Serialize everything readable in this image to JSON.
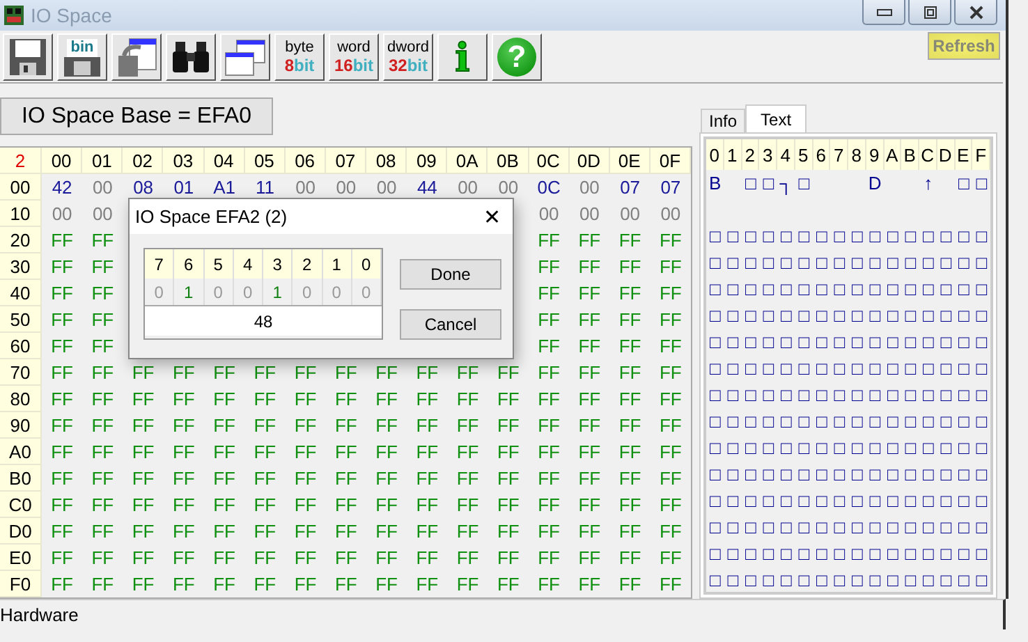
{
  "window": {
    "title": "IO Space"
  },
  "toolbar": [
    {
      "kind": "save"
    },
    {
      "kind": "bin",
      "label": "bin"
    },
    {
      "kind": "copy"
    },
    {
      "kind": "find"
    },
    {
      "kind": "windows"
    },
    {
      "kind": "size",
      "top": "byte",
      "num": "8",
      "unit": "bit"
    },
    {
      "kind": "size",
      "top": "word",
      "num": "16",
      "unit": "bit"
    },
    {
      "kind": "size",
      "top": "dword",
      "num": "32",
      "unit": "bit"
    },
    {
      "kind": "info",
      "glyph": "i"
    },
    {
      "kind": "help",
      "glyph": "?"
    }
  ],
  "refresh_button": "Refresh",
  "base_label": "IO Space Base = EFA0",
  "grid": {
    "corner": "2",
    "columns": [
      "00",
      "01",
      "02",
      "03",
      "04",
      "05",
      "06",
      "07",
      "08",
      "09",
      "0A",
      "0B",
      "0C",
      "0D",
      "0E",
      "0F"
    ],
    "rows": [
      {
        "label": "00",
        "cells": [
          {
            "text": "42",
            "kind": "data"
          },
          {
            "text": "00",
            "kind": "zero"
          },
          {
            "text": "08",
            "kind": "data"
          },
          {
            "text": "01",
            "kind": "data"
          },
          {
            "text": "A1",
            "kind": "data"
          },
          {
            "text": "11",
            "kind": "data"
          },
          {
            "text": "00",
            "kind": "zero"
          },
          {
            "text": "00",
            "kind": "zero"
          },
          {
            "text": "00",
            "kind": "zero"
          },
          {
            "text": "44",
            "kind": "data"
          },
          {
            "text": "00",
            "kind": "zero"
          },
          {
            "text": "00",
            "kind": "zero"
          },
          {
            "text": "0C",
            "kind": "data"
          },
          {
            "text": "00",
            "kind": "zero"
          },
          {
            "text": "07",
            "kind": "data"
          },
          {
            "text": "07",
            "kind": "data"
          }
        ]
      },
      {
        "label": "10",
        "cells": [
          {
            "text": "00",
            "kind": "zero"
          },
          {
            "text": "00",
            "kind": "zero"
          },
          null,
          null,
          null,
          null,
          null,
          null,
          null,
          null,
          null,
          null,
          {
            "text": "00",
            "kind": "zero"
          },
          {
            "text": "00",
            "kind": "zero"
          },
          {
            "text": "00",
            "kind": "zero"
          },
          {
            "text": "00",
            "kind": "zero"
          }
        ]
      },
      {
        "label": "20",
        "cells": [
          {
            "text": "FF",
            "kind": "full"
          },
          {
            "text": "FF",
            "kind": "full"
          },
          null,
          null,
          null,
          null,
          null,
          null,
          null,
          null,
          null,
          null,
          {
            "text": "FF",
            "kind": "full"
          },
          {
            "text": "FF",
            "kind": "full"
          },
          {
            "text": "FF",
            "kind": "full"
          },
          {
            "text": "FF",
            "kind": "full"
          }
        ]
      },
      {
        "label": "30",
        "cells": [
          {
            "text": "FF",
            "kind": "full"
          },
          {
            "text": "FF",
            "kind": "full"
          },
          null,
          null,
          null,
          null,
          null,
          null,
          null,
          null,
          null,
          null,
          {
            "text": "FF",
            "kind": "full"
          },
          {
            "text": "FF",
            "kind": "full"
          },
          {
            "text": "FF",
            "kind": "full"
          },
          {
            "text": "FF",
            "kind": "full"
          }
        ]
      },
      {
        "label": "40",
        "cells": [
          {
            "text": "FF",
            "kind": "full"
          },
          {
            "text": "FF",
            "kind": "full"
          },
          null,
          null,
          null,
          null,
          null,
          null,
          null,
          null,
          null,
          null,
          {
            "text": "FF",
            "kind": "full"
          },
          {
            "text": "FF",
            "kind": "full"
          },
          {
            "text": "FF",
            "kind": "full"
          },
          {
            "text": "FF",
            "kind": "full"
          }
        ]
      },
      {
        "label": "50",
        "cells": [
          {
            "text": "FF",
            "kind": "full"
          },
          {
            "text": "FF",
            "kind": "full"
          },
          null,
          null,
          null,
          null,
          null,
          null,
          null,
          null,
          null,
          null,
          {
            "text": "FF",
            "kind": "full"
          },
          {
            "text": "FF",
            "kind": "full"
          },
          {
            "text": "FF",
            "kind": "full"
          },
          {
            "text": "FF",
            "kind": "full"
          }
        ]
      },
      {
        "label": "60",
        "cells": [
          {
            "text": "FF",
            "kind": "full"
          },
          {
            "text": "FF",
            "kind": "full"
          },
          null,
          null,
          null,
          null,
          null,
          null,
          null,
          null,
          null,
          null,
          {
            "text": "FF",
            "kind": "full"
          },
          {
            "text": "FF",
            "kind": "full"
          },
          {
            "text": "FF",
            "kind": "full"
          },
          {
            "text": "FF",
            "kind": "full"
          }
        ]
      },
      {
        "label": "70",
        "cells": [
          {
            "text": "FF",
            "kind": "full"
          },
          {
            "text": "FF",
            "kind": "full"
          },
          {
            "text": "FF",
            "kind": "full"
          },
          {
            "text": "FF",
            "kind": "full"
          },
          {
            "text": "FF",
            "kind": "full"
          },
          {
            "text": "FF",
            "kind": "full"
          },
          {
            "text": "FF",
            "kind": "full"
          },
          {
            "text": "FF",
            "kind": "full"
          },
          {
            "text": "FF",
            "kind": "full"
          },
          {
            "text": "FF",
            "kind": "full"
          },
          {
            "text": "FF",
            "kind": "full"
          },
          {
            "text": "FF",
            "kind": "full"
          },
          {
            "text": "FF",
            "kind": "full"
          },
          {
            "text": "FF",
            "kind": "full"
          },
          {
            "text": "FF",
            "kind": "full"
          },
          {
            "text": "FF",
            "kind": "full"
          }
        ]
      },
      {
        "label": "80",
        "cells": [
          {
            "text": "FF",
            "kind": "full"
          },
          {
            "text": "FF",
            "kind": "full"
          },
          {
            "text": "FF",
            "kind": "full"
          },
          {
            "text": "FF",
            "kind": "full"
          },
          {
            "text": "FF",
            "kind": "full"
          },
          {
            "text": "FF",
            "kind": "full"
          },
          {
            "text": "FF",
            "kind": "full"
          },
          {
            "text": "FF",
            "kind": "full"
          },
          {
            "text": "FF",
            "kind": "full"
          },
          {
            "text": "FF",
            "kind": "full"
          },
          {
            "text": "FF",
            "kind": "full"
          },
          {
            "text": "FF",
            "kind": "full"
          },
          {
            "text": "FF",
            "kind": "full"
          },
          {
            "text": "FF",
            "kind": "full"
          },
          {
            "text": "FF",
            "kind": "full"
          },
          {
            "text": "FF",
            "kind": "full"
          }
        ]
      },
      {
        "label": "90",
        "cells": [
          {
            "text": "FF",
            "kind": "full"
          },
          {
            "text": "FF",
            "kind": "full"
          },
          {
            "text": "FF",
            "kind": "full"
          },
          {
            "text": "FF",
            "kind": "full"
          },
          {
            "text": "FF",
            "kind": "full"
          },
          {
            "text": "FF",
            "kind": "full"
          },
          {
            "text": "FF",
            "kind": "full"
          },
          {
            "text": "FF",
            "kind": "full"
          },
          {
            "text": "FF",
            "kind": "full"
          },
          {
            "text": "FF",
            "kind": "full"
          },
          {
            "text": "FF",
            "kind": "full"
          },
          {
            "text": "FF",
            "kind": "full"
          },
          {
            "text": "FF",
            "kind": "full"
          },
          {
            "text": "FF",
            "kind": "full"
          },
          {
            "text": "FF",
            "kind": "full"
          },
          {
            "text": "FF",
            "kind": "full"
          }
        ]
      },
      {
        "label": "A0",
        "cells": [
          {
            "text": "FF",
            "kind": "full"
          },
          {
            "text": "FF",
            "kind": "full"
          },
          {
            "text": "FF",
            "kind": "full"
          },
          {
            "text": "FF",
            "kind": "full"
          },
          {
            "text": "FF",
            "kind": "full"
          },
          {
            "text": "FF",
            "kind": "full"
          },
          {
            "text": "FF",
            "kind": "full"
          },
          {
            "text": "FF",
            "kind": "full"
          },
          {
            "text": "FF",
            "kind": "full"
          },
          {
            "text": "FF",
            "kind": "full"
          },
          {
            "text": "FF",
            "kind": "full"
          },
          {
            "text": "FF",
            "kind": "full"
          },
          {
            "text": "FF",
            "kind": "full"
          },
          {
            "text": "FF",
            "kind": "full"
          },
          {
            "text": "FF",
            "kind": "full"
          },
          {
            "text": "FF",
            "kind": "full"
          }
        ]
      },
      {
        "label": "B0",
        "cells": [
          {
            "text": "FF",
            "kind": "full"
          },
          {
            "text": "FF",
            "kind": "full"
          },
          {
            "text": "FF",
            "kind": "full"
          },
          {
            "text": "FF",
            "kind": "full"
          },
          {
            "text": "FF",
            "kind": "full"
          },
          {
            "text": "FF",
            "kind": "full"
          },
          {
            "text": "FF",
            "kind": "full"
          },
          {
            "text": "FF",
            "kind": "full"
          },
          {
            "text": "FF",
            "kind": "full"
          },
          {
            "text": "FF",
            "kind": "full"
          },
          {
            "text": "FF",
            "kind": "full"
          },
          {
            "text": "FF",
            "kind": "full"
          },
          {
            "text": "FF",
            "kind": "full"
          },
          {
            "text": "FF",
            "kind": "full"
          },
          {
            "text": "FF",
            "kind": "full"
          },
          {
            "text": "FF",
            "kind": "full"
          }
        ]
      },
      {
        "label": "C0",
        "cells": [
          {
            "text": "FF",
            "kind": "full"
          },
          {
            "text": "FF",
            "kind": "full"
          },
          {
            "text": "FF",
            "kind": "full"
          },
          {
            "text": "FF",
            "kind": "full"
          },
          {
            "text": "FF",
            "kind": "full"
          },
          {
            "text": "FF",
            "kind": "full"
          },
          {
            "text": "FF",
            "kind": "full"
          },
          {
            "text": "FF",
            "kind": "full"
          },
          {
            "text": "FF",
            "kind": "full"
          },
          {
            "text": "FF",
            "kind": "full"
          },
          {
            "text": "FF",
            "kind": "full"
          },
          {
            "text": "FF",
            "kind": "full"
          },
          {
            "text": "FF",
            "kind": "full"
          },
          {
            "text": "FF",
            "kind": "full"
          },
          {
            "text": "FF",
            "kind": "full"
          },
          {
            "text": "FF",
            "kind": "full"
          }
        ]
      },
      {
        "label": "D0",
        "cells": [
          {
            "text": "FF",
            "kind": "full"
          },
          {
            "text": "FF",
            "kind": "full"
          },
          {
            "text": "FF",
            "kind": "full"
          },
          {
            "text": "FF",
            "kind": "full"
          },
          {
            "text": "FF",
            "kind": "full"
          },
          {
            "text": "FF",
            "kind": "full"
          },
          {
            "text": "FF",
            "kind": "full"
          },
          {
            "text": "FF",
            "kind": "full"
          },
          {
            "text": "FF",
            "kind": "full"
          },
          {
            "text": "FF",
            "kind": "full"
          },
          {
            "text": "FF",
            "kind": "full"
          },
          {
            "text": "FF",
            "kind": "full"
          },
          {
            "text": "FF",
            "kind": "full"
          },
          {
            "text": "FF",
            "kind": "full"
          },
          {
            "text": "FF",
            "kind": "full"
          },
          {
            "text": "FF",
            "kind": "full"
          }
        ]
      },
      {
        "label": "E0",
        "cells": [
          {
            "text": "FF",
            "kind": "full"
          },
          {
            "text": "FF",
            "kind": "full"
          },
          {
            "text": "FF",
            "kind": "full"
          },
          {
            "text": "FF",
            "kind": "full"
          },
          {
            "text": "FF",
            "kind": "full"
          },
          {
            "text": "FF",
            "kind": "full"
          },
          {
            "text": "FF",
            "kind": "full"
          },
          {
            "text": "FF",
            "kind": "full"
          },
          {
            "text": "FF",
            "kind": "full"
          },
          {
            "text": "FF",
            "kind": "full"
          },
          {
            "text": "FF",
            "kind": "full"
          },
          {
            "text": "FF",
            "kind": "full"
          },
          {
            "text": "FF",
            "kind": "full"
          },
          {
            "text": "FF",
            "kind": "full"
          },
          {
            "text": "FF",
            "kind": "full"
          },
          {
            "text": "FF",
            "kind": "full"
          }
        ]
      },
      {
        "label": "F0",
        "cells": [
          {
            "text": "FF",
            "kind": "full"
          },
          {
            "text": "FF",
            "kind": "full"
          },
          {
            "text": "FF",
            "kind": "full"
          },
          {
            "text": "FF",
            "kind": "full"
          },
          {
            "text": "FF",
            "kind": "full"
          },
          {
            "text": "FF",
            "kind": "full"
          },
          {
            "text": "FF",
            "kind": "full"
          },
          {
            "text": "FF",
            "kind": "full"
          },
          {
            "text": "FF",
            "kind": "full"
          },
          {
            "text": "FF",
            "kind": "full"
          },
          {
            "text": "FF",
            "kind": "full"
          },
          {
            "text": "FF",
            "kind": "full"
          },
          {
            "text": "FF",
            "kind": "full"
          },
          {
            "text": "FF",
            "kind": "full"
          },
          {
            "text": "FF",
            "kind": "full"
          },
          {
            "text": "FF",
            "kind": "full"
          }
        ]
      }
    ]
  },
  "tabs": [
    {
      "label": "Info",
      "selected": false
    },
    {
      "label": "Text",
      "selected": true
    }
  ],
  "text_panel": {
    "columns": [
      "0",
      "1",
      "2",
      "3",
      "4",
      "5",
      "6",
      "7",
      "8",
      "9",
      "A",
      "B",
      "C",
      "D",
      "E",
      "F"
    ],
    "rows": [
      [
        "B",
        null,
        "□",
        "□",
        "┐",
        "□",
        null,
        null,
        null,
        "D",
        null,
        null,
        "↑",
        null,
        "□",
        "□"
      ],
      [
        null,
        null,
        null,
        null,
        null,
        null,
        null,
        null,
        null,
        null,
        null,
        null,
        null,
        null,
        null,
        null
      ],
      [
        "□",
        "□",
        "□",
        "□",
        "□",
        "□",
        "□",
        "□",
        "□",
        "□",
        "□",
        "□",
        "□",
        "□",
        "□",
        "□"
      ],
      [
        "□",
        "□",
        "□",
        "□",
        "□",
        "□",
        "□",
        "□",
        "□",
        "□",
        "□",
        "□",
        "□",
        "□",
        "□",
        "□"
      ],
      [
        "□",
        "□",
        "□",
        "□",
        "□",
        "□",
        "□",
        "□",
        "□",
        "□",
        "□",
        "□",
        "□",
        "□",
        "□",
        "□"
      ],
      [
        "□",
        "□",
        "□",
        "□",
        "□",
        "□",
        "□",
        "□",
        "□",
        "□",
        "□",
        "□",
        "□",
        "□",
        "□",
        "□"
      ],
      [
        "□",
        "□",
        "□",
        "□",
        "□",
        "□",
        "□",
        "□",
        "□",
        "□",
        "□",
        "□",
        "□",
        "□",
        "□",
        "□"
      ],
      [
        "□",
        "□",
        "□",
        "□",
        "□",
        "□",
        "□",
        "□",
        "□",
        "□",
        "□",
        "□",
        "□",
        "□",
        "□",
        "□"
      ],
      [
        "□",
        "□",
        "□",
        "□",
        "□",
        "□",
        "□",
        "□",
        "□",
        "□",
        "□",
        "□",
        "□",
        "□",
        "□",
        "□"
      ],
      [
        "□",
        "□",
        "□",
        "□",
        "□",
        "□",
        "□",
        "□",
        "□",
        "□",
        "□",
        "□",
        "□",
        "□",
        "□",
        "□"
      ],
      [
        "□",
        "□",
        "□",
        "□",
        "□",
        "□",
        "□",
        "□",
        "□",
        "□",
        "□",
        "□",
        "□",
        "□",
        "□",
        "□"
      ],
      [
        "□",
        "□",
        "□",
        "□",
        "□",
        "□",
        "□",
        "□",
        "□",
        "□",
        "□",
        "□",
        "□",
        "□",
        "□",
        "□"
      ],
      [
        "□",
        "□",
        "□",
        "□",
        "□",
        "□",
        "□",
        "□",
        "□",
        "□",
        "□",
        "□",
        "□",
        "□",
        "□",
        "□"
      ],
      [
        "□",
        "□",
        "□",
        "□",
        "□",
        "□",
        "□",
        "□",
        "□",
        "□",
        "□",
        "□",
        "□",
        "□",
        "□",
        "□"
      ],
      [
        "□",
        "□",
        "□",
        "□",
        "□",
        "□",
        "□",
        "□",
        "□",
        "□",
        "□",
        "□",
        "□",
        "□",
        "□",
        "□"
      ],
      [
        "□",
        "□",
        "□",
        "□",
        "□",
        "□",
        "□",
        "□",
        "□",
        "□",
        "□",
        "□",
        "□",
        "□",
        "□",
        "□"
      ]
    ]
  },
  "dialog": {
    "title": "IO Space EFA2 (2)",
    "close": "✕",
    "bits": [
      {
        "label": "7",
        "value": "0",
        "on": false
      },
      {
        "label": "6",
        "value": "1",
        "on": true
      },
      {
        "label": "5",
        "value": "0",
        "on": false
      },
      {
        "label": "4",
        "value": "0",
        "on": false
      },
      {
        "label": "3",
        "value": "1",
        "on": true
      },
      {
        "label": "2",
        "value": "0",
        "on": false
      },
      {
        "label": "1",
        "value": "0",
        "on": false
      },
      {
        "label": "0",
        "value": "0",
        "on": false
      }
    ],
    "value": "48",
    "buttons": [
      "Done",
      "Cancel"
    ]
  },
  "status_bar": "Hardware"
}
